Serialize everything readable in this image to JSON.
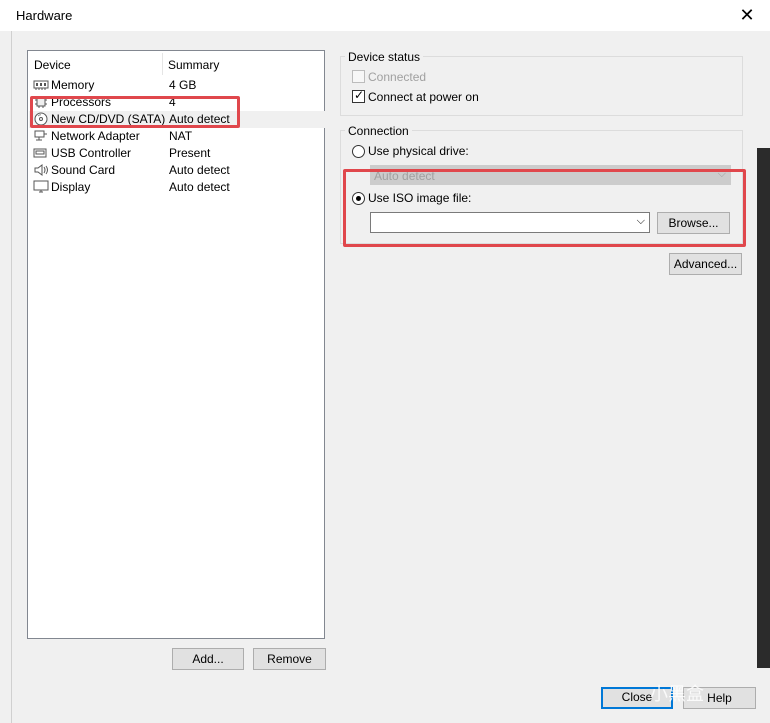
{
  "window": {
    "title": "Hardware",
    "close_glyph": "✕"
  },
  "device_list": {
    "headers": {
      "device": "Device",
      "summary": "Summary"
    },
    "rows": [
      {
        "name": "Memory",
        "summary": "4 GB",
        "icon": "memory-icon"
      },
      {
        "name": "Processors",
        "summary": "4",
        "icon": "processor-icon"
      },
      {
        "name": "New CD/DVD (SATA)",
        "summary": "Auto detect",
        "icon": "cd-dvd-icon"
      },
      {
        "name": "Network Adapter",
        "summary": "NAT",
        "icon": "network-adapter-icon"
      },
      {
        "name": "USB Controller",
        "summary": "Present",
        "icon": "usb-icon"
      },
      {
        "name": "Sound Card",
        "summary": "Auto detect",
        "icon": "sound-icon"
      },
      {
        "name": "Display",
        "summary": "Auto detect",
        "icon": "display-icon"
      }
    ],
    "selected_index": 2
  },
  "buttons": {
    "add": "Add...",
    "remove": "Remove",
    "browse": "Browse...",
    "advanced": "Advanced...",
    "close": "Close",
    "help": "Help"
  },
  "device_status": {
    "title": "Device status",
    "connected": {
      "label": "Connected",
      "checked": false,
      "enabled": false
    },
    "connect_at_power_on": {
      "label": "Connect at power on",
      "checked": true
    }
  },
  "connection": {
    "title": "Connection",
    "physical_drive": {
      "label": "Use physical drive:",
      "selected": false,
      "value": "Auto detect"
    },
    "iso_image": {
      "label": "Use ISO image file:",
      "selected": true,
      "value": ""
    }
  },
  "watermark": "小黑盒",
  "colors": {
    "highlight": "#e0474c",
    "accent": "#0078d7"
  }
}
